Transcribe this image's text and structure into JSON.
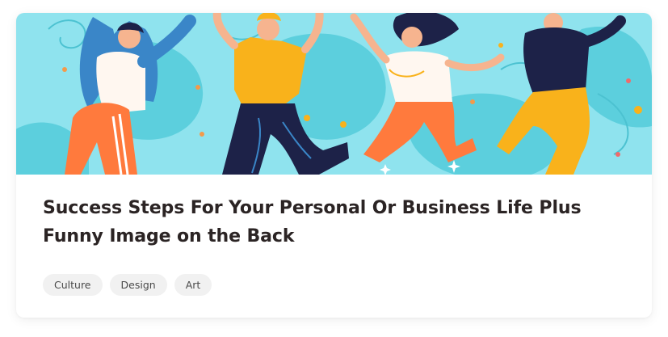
{
  "card": {
    "title": "Success Steps For Your Personal Or Business Life Plus Funny Image on the Back",
    "image": {
      "icon": "dancing-people-illustration",
      "colors": {
        "background": "#8fe3ee",
        "blob": "#5ccfdd",
        "navy": "#1d2248",
        "orange": "#ff7a3d",
        "yellow": "#f9b21b",
        "blue": "#3a86c8"
      }
    },
    "tags": [
      {
        "label": "Culture"
      },
      {
        "label": "Design"
      },
      {
        "label": "Art"
      }
    ]
  }
}
